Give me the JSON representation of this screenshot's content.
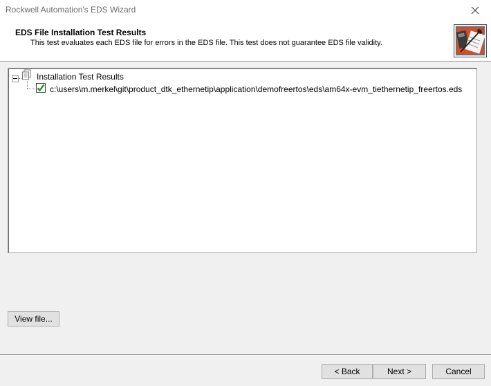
{
  "window": {
    "title": "Rockwell Automation's EDS Wizard",
    "close_icon": "close-icon"
  },
  "header": {
    "title": "EDS File Installation Test Results",
    "subtitle": "This test evaluates each EDS file for errors in the EDS file. This test does not guarantee EDS file validity.",
    "icon": "wizard-icon"
  },
  "tree": {
    "root_label": "Installation Test Results",
    "root_icon": "document-tree-icon",
    "items": [
      {
        "label": "c:\\users\\m.merkel\\git\\product_dtk_ethernetip\\application\\demofreertos\\eds\\am64x-evm_tiethernetip_freertos.eds",
        "status_icon": "check-icon"
      }
    ]
  },
  "buttons": {
    "view_file": "View file...",
    "back": "< Back",
    "next": "Next >",
    "cancel": "Cancel"
  },
  "colors": {
    "check_green": "#1a9c1a",
    "icon_red": "#d64b2a"
  }
}
